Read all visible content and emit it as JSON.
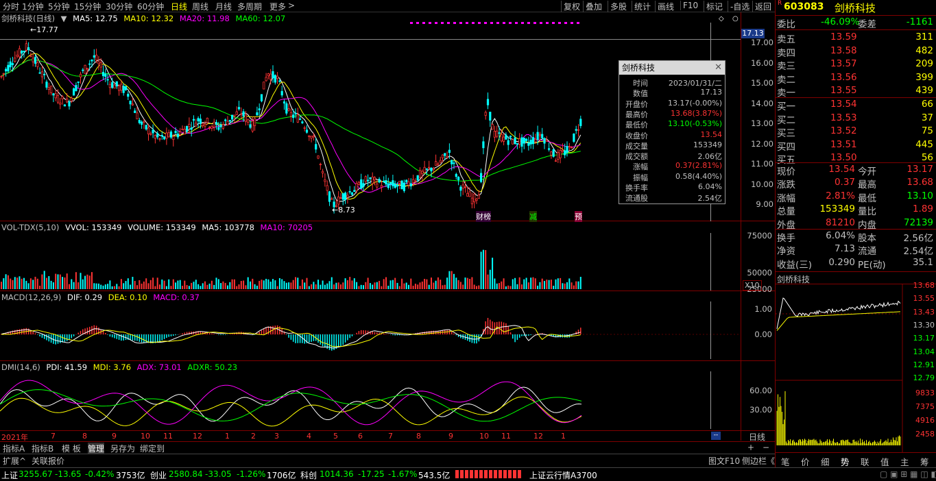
{
  "toolbar": {
    "periods": [
      "分时",
      "1分钟",
      "5分钟",
      "15分钟",
      "30分钟",
      "60分钟",
      "日线",
      "周线",
      "月线",
      "多周期",
      "更多"
    ],
    "right": [
      "复权",
      "叠加",
      "多股",
      "统计",
      "画线",
      "F10",
      "标记",
      "-自选",
      "返回"
    ]
  },
  "kline": {
    "legend": {
      "name": "剑桥科技(日线)",
      "ma5": "MA5: 12.75",
      "ma10": "MA10: 12.32",
      "ma20": "MA20: 11.98",
      "ma60": "MA60: 12.07"
    },
    "yticks": [
      "17.00",
      "16.00",
      "15.00",
      "14.00",
      "13.00",
      "12.00",
      "11.00",
      "10.00",
      "9.00"
    ],
    "high_label": "17.77",
    "low_label": "8.73",
    "cursor_price": "17.13",
    "markers": [
      "财榜",
      "减",
      "预"
    ]
  },
  "volume": {
    "legend": {
      "name": "VOL-TDX(5,10)",
      "vvol": "VVOL: 153349",
      "volume": "VOLUME: 153349",
      "ma5": "MA5: 103778",
      "ma10": "MA10: 70205"
    },
    "yticks": [
      "75000",
      "50000",
      "25000"
    ],
    "unit": "X10"
  },
  "macd": {
    "legend": {
      "name": "MACD(12,26,9)",
      "dif": "DIF: 0.29",
      "dea": "DEA: 0.10",
      "macd": "MACD: 0.37"
    },
    "yticks": [
      "1.00",
      "0.00"
    ]
  },
  "dmi": {
    "legend": {
      "name": "DMI(14,6)",
      "pdi": "PDI: 41.59",
      "mdi": "MDI: 3.76",
      "adx": "ADX: 73.01",
      "adxr": "ADXR: 50.23"
    },
    "yticks": [
      "60.00",
      "30.00"
    ]
  },
  "xaxis": {
    "labels": [
      "2021年",
      "7",
      "8",
      "9",
      "10",
      "11",
      "12",
      "1",
      "2",
      "3",
      "4",
      "5",
      "6",
      "7",
      "8",
      "9",
      "10",
      "11",
      "12",
      "1"
    ],
    "period_label": "日线"
  },
  "tooltip": {
    "title": "剑桥科技",
    "rows": [
      {
        "k": "时间",
        "v": "2023/01/31/二"
      },
      {
        "k": "数值",
        "v": "17.13"
      },
      {
        "k": "开盘价",
        "v": "13.17(-0.00%)"
      },
      {
        "k": "最高价",
        "v": "13.68(3.87%)"
      },
      {
        "k": "最低价",
        "v": "13.10(-0.53%)"
      },
      {
        "k": "收盘价",
        "v": "13.54"
      },
      {
        "k": "成交量",
        "v": "153349"
      },
      {
        "k": "成交额",
        "v": "2.06亿"
      },
      {
        "k": "涨幅",
        "v": "0.37(2.81%)"
      },
      {
        "k": "振幅",
        "v": "0.58(4.40%)"
      },
      {
        "k": "换手率",
        "v": "6.04%"
      },
      {
        "k": "流通股",
        "v": "2.54亿"
      }
    ]
  },
  "bottom_tabs": [
    "指标A",
    "指标B",
    "模 板",
    "管理",
    "另存为",
    "绑定到"
  ],
  "bottom_row2": [
    "扩展^",
    "关联报价"
  ],
  "quote": {
    "badge": "R",
    "code": "603083",
    "name": "剑桥科技",
    "weibi_label": "委比",
    "weibi": "-46.09%",
    "weicha_label": "委差",
    "weicha": "-1161",
    "asks": [
      {
        "label": "卖五",
        "price": "13.59",
        "vol": "311"
      },
      {
        "label": "卖四",
        "price": "13.58",
        "vol": "482"
      },
      {
        "label": "卖三",
        "price": "13.57",
        "vol": "209"
      },
      {
        "label": "卖二",
        "price": "13.56",
        "vol": "399"
      },
      {
        "label": "卖一",
        "price": "13.55",
        "vol": "439"
      }
    ],
    "bids": [
      {
        "label": "买一",
        "price": "13.54",
        "vol": "66"
      },
      {
        "label": "买二",
        "price": "13.53",
        "vol": "37"
      },
      {
        "label": "买三",
        "price": "13.52",
        "vol": "75"
      },
      {
        "label": "买四",
        "price": "13.51",
        "vol": "445"
      },
      {
        "label": "买五",
        "price": "13.50",
        "vol": "56"
      }
    ],
    "stats": [
      {
        "l1": "现价",
        "v1": "13.54",
        "l2": "今开",
        "v2": "13.17"
      },
      {
        "l1": "涨跌",
        "v1": "0.37",
        "l2": "最高",
        "v2": "13.68"
      },
      {
        "l1": "涨幅",
        "v1": "2.81%",
        "l2": "最低",
        "v2": "13.10"
      },
      {
        "l1": "总量",
        "v1": "153349",
        "l2": "量比",
        "v2": "1.89"
      },
      {
        "l1": "外盘",
        "v1": "81210",
        "l2": "内盘",
        "v2": "72139"
      }
    ],
    "stats2": [
      {
        "l1": "换手",
        "v1": "6.04%",
        "l2": "股本",
        "v2": "2.56亿"
      },
      {
        "l1": "净资",
        "v1": "7.13",
        "l2": "流通",
        "v2": "2.54亿"
      },
      {
        "l1": "收益(三)",
        "v1": "0.290",
        "l2": "PE(动)",
        "v2": "35.1"
      }
    ],
    "mini_title": "剑桥科技",
    "mini_yticks": [
      "13.68",
      "13.55",
      "13.43",
      "13.30",
      "13.17",
      "13.04",
      "12.91",
      "12.79"
    ],
    "mini_vticks": [
      "9833",
      "7375",
      "4916",
      "2458"
    ],
    "tabs": [
      "笔",
      "价",
      "细",
      "势",
      "联",
      "值",
      "主",
      "筹"
    ]
  },
  "side_buttons": [
    "图文F10",
    "侧边栏《"
  ],
  "statusbar": {
    "sh_name": "上证",
    "sh_val": "3255.67",
    "sh_chg": "-13.65",
    "sh_pct": "-0.42%",
    "sh_amt": "3753亿",
    "cy_name": "创业",
    "cy_val": "2580.84",
    "cy_chg": "-33.05",
    "cy_pct": "-1.26%",
    "cy_amt": "1706亿",
    "kc_name": "科创",
    "kc_val": "1014.36",
    "kc_chg": "-17.25",
    "kc_pct": "-1.67%",
    "kc_amt": "543.5亿",
    "news": "上证云行情A3700"
  }
}
